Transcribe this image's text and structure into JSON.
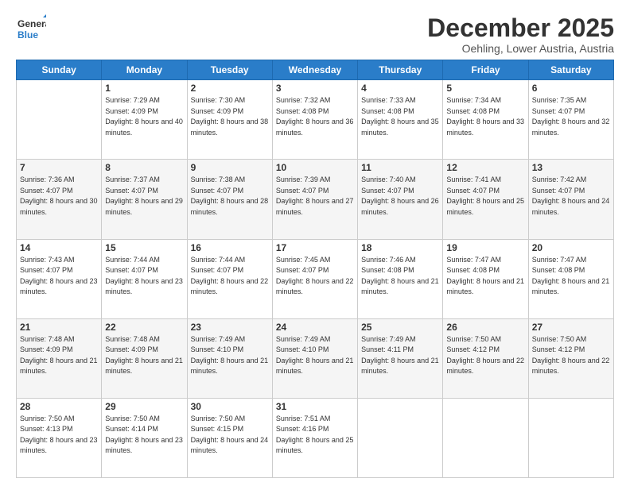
{
  "logo": {
    "line1": "General",
    "line2": "Blue"
  },
  "title": "December 2025",
  "subtitle": "Oehling, Lower Austria, Austria",
  "header_days": [
    "Sunday",
    "Monday",
    "Tuesday",
    "Wednesday",
    "Thursday",
    "Friday",
    "Saturday"
  ],
  "weeks": [
    [
      {
        "day": "",
        "sunrise": "",
        "sunset": "",
        "daylight": ""
      },
      {
        "day": "1",
        "sunrise": "Sunrise: 7:29 AM",
        "sunset": "Sunset: 4:09 PM",
        "daylight": "Daylight: 8 hours and 40 minutes."
      },
      {
        "day": "2",
        "sunrise": "Sunrise: 7:30 AM",
        "sunset": "Sunset: 4:09 PM",
        "daylight": "Daylight: 8 hours and 38 minutes."
      },
      {
        "day": "3",
        "sunrise": "Sunrise: 7:32 AM",
        "sunset": "Sunset: 4:08 PM",
        "daylight": "Daylight: 8 hours and 36 minutes."
      },
      {
        "day": "4",
        "sunrise": "Sunrise: 7:33 AM",
        "sunset": "Sunset: 4:08 PM",
        "daylight": "Daylight: 8 hours and 35 minutes."
      },
      {
        "day": "5",
        "sunrise": "Sunrise: 7:34 AM",
        "sunset": "Sunset: 4:08 PM",
        "daylight": "Daylight: 8 hours and 33 minutes."
      },
      {
        "day": "6",
        "sunrise": "Sunrise: 7:35 AM",
        "sunset": "Sunset: 4:07 PM",
        "daylight": "Daylight: 8 hours and 32 minutes."
      }
    ],
    [
      {
        "day": "7",
        "sunrise": "Sunrise: 7:36 AM",
        "sunset": "Sunset: 4:07 PM",
        "daylight": "Daylight: 8 hours and 30 minutes."
      },
      {
        "day": "8",
        "sunrise": "Sunrise: 7:37 AM",
        "sunset": "Sunset: 4:07 PM",
        "daylight": "Daylight: 8 hours and 29 minutes."
      },
      {
        "day": "9",
        "sunrise": "Sunrise: 7:38 AM",
        "sunset": "Sunset: 4:07 PM",
        "daylight": "Daylight: 8 hours and 28 minutes."
      },
      {
        "day": "10",
        "sunrise": "Sunrise: 7:39 AM",
        "sunset": "Sunset: 4:07 PM",
        "daylight": "Daylight: 8 hours and 27 minutes."
      },
      {
        "day": "11",
        "sunrise": "Sunrise: 7:40 AM",
        "sunset": "Sunset: 4:07 PM",
        "daylight": "Daylight: 8 hours and 26 minutes."
      },
      {
        "day": "12",
        "sunrise": "Sunrise: 7:41 AM",
        "sunset": "Sunset: 4:07 PM",
        "daylight": "Daylight: 8 hours and 25 minutes."
      },
      {
        "day": "13",
        "sunrise": "Sunrise: 7:42 AM",
        "sunset": "Sunset: 4:07 PM",
        "daylight": "Daylight: 8 hours and 24 minutes."
      }
    ],
    [
      {
        "day": "14",
        "sunrise": "Sunrise: 7:43 AM",
        "sunset": "Sunset: 4:07 PM",
        "daylight": "Daylight: 8 hours and 23 minutes."
      },
      {
        "day": "15",
        "sunrise": "Sunrise: 7:44 AM",
        "sunset": "Sunset: 4:07 PM",
        "daylight": "Daylight: 8 hours and 23 minutes."
      },
      {
        "day": "16",
        "sunrise": "Sunrise: 7:44 AM",
        "sunset": "Sunset: 4:07 PM",
        "daylight": "Daylight: 8 hours and 22 minutes."
      },
      {
        "day": "17",
        "sunrise": "Sunrise: 7:45 AM",
        "sunset": "Sunset: 4:07 PM",
        "daylight": "Daylight: 8 hours and 22 minutes."
      },
      {
        "day": "18",
        "sunrise": "Sunrise: 7:46 AM",
        "sunset": "Sunset: 4:08 PM",
        "daylight": "Daylight: 8 hours and 21 minutes."
      },
      {
        "day": "19",
        "sunrise": "Sunrise: 7:47 AM",
        "sunset": "Sunset: 4:08 PM",
        "daylight": "Daylight: 8 hours and 21 minutes."
      },
      {
        "day": "20",
        "sunrise": "Sunrise: 7:47 AM",
        "sunset": "Sunset: 4:08 PM",
        "daylight": "Daylight: 8 hours and 21 minutes."
      }
    ],
    [
      {
        "day": "21",
        "sunrise": "Sunrise: 7:48 AM",
        "sunset": "Sunset: 4:09 PM",
        "daylight": "Daylight: 8 hours and 21 minutes."
      },
      {
        "day": "22",
        "sunrise": "Sunrise: 7:48 AM",
        "sunset": "Sunset: 4:09 PM",
        "daylight": "Daylight: 8 hours and 21 minutes."
      },
      {
        "day": "23",
        "sunrise": "Sunrise: 7:49 AM",
        "sunset": "Sunset: 4:10 PM",
        "daylight": "Daylight: 8 hours and 21 minutes."
      },
      {
        "day": "24",
        "sunrise": "Sunrise: 7:49 AM",
        "sunset": "Sunset: 4:10 PM",
        "daylight": "Daylight: 8 hours and 21 minutes."
      },
      {
        "day": "25",
        "sunrise": "Sunrise: 7:49 AM",
        "sunset": "Sunset: 4:11 PM",
        "daylight": "Daylight: 8 hours and 21 minutes."
      },
      {
        "day": "26",
        "sunrise": "Sunrise: 7:50 AM",
        "sunset": "Sunset: 4:12 PM",
        "daylight": "Daylight: 8 hours and 22 minutes."
      },
      {
        "day": "27",
        "sunrise": "Sunrise: 7:50 AM",
        "sunset": "Sunset: 4:12 PM",
        "daylight": "Daylight: 8 hours and 22 minutes."
      }
    ],
    [
      {
        "day": "28",
        "sunrise": "Sunrise: 7:50 AM",
        "sunset": "Sunset: 4:13 PM",
        "daylight": "Daylight: 8 hours and 23 minutes."
      },
      {
        "day": "29",
        "sunrise": "Sunrise: 7:50 AM",
        "sunset": "Sunset: 4:14 PM",
        "daylight": "Daylight: 8 hours and 23 minutes."
      },
      {
        "day": "30",
        "sunrise": "Sunrise: 7:50 AM",
        "sunset": "Sunset: 4:15 PM",
        "daylight": "Daylight: 8 hours and 24 minutes."
      },
      {
        "day": "31",
        "sunrise": "Sunrise: 7:51 AM",
        "sunset": "Sunset: 4:16 PM",
        "daylight": "Daylight: 8 hours and 25 minutes."
      },
      {
        "day": "",
        "sunrise": "",
        "sunset": "",
        "daylight": ""
      },
      {
        "day": "",
        "sunrise": "",
        "sunset": "",
        "daylight": ""
      },
      {
        "day": "",
        "sunrise": "",
        "sunset": "",
        "daylight": ""
      }
    ]
  ]
}
